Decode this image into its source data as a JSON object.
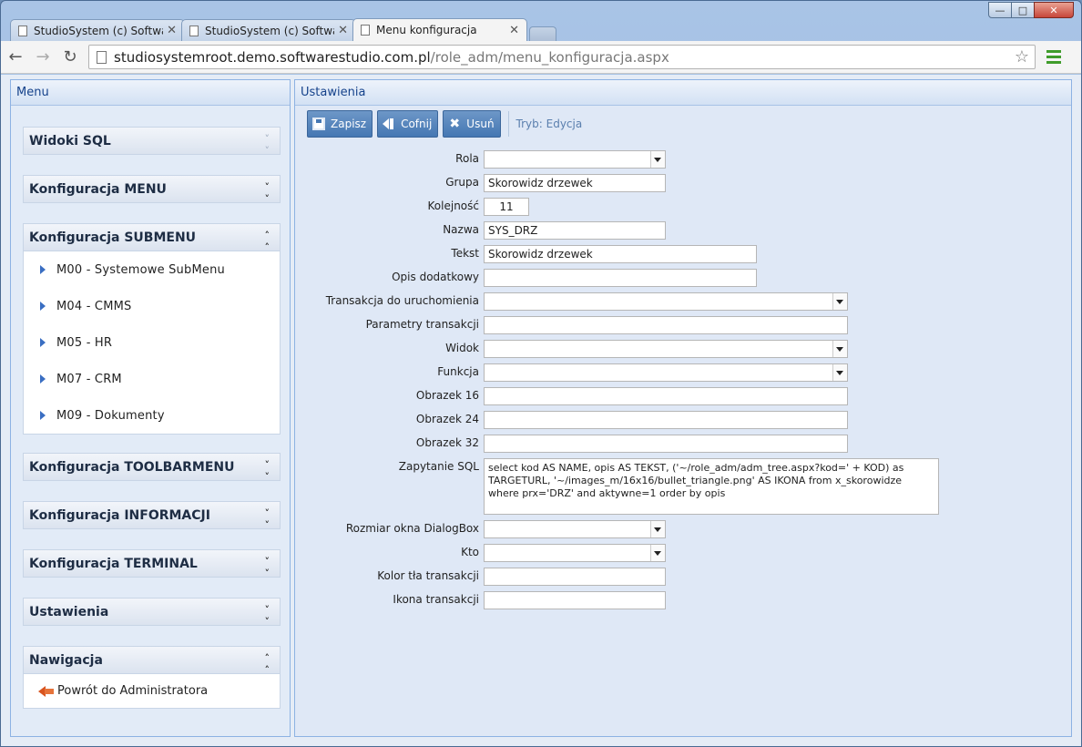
{
  "browser": {
    "tabs": [
      {
        "label": "StudioSystem (c) Software",
        "active": false
      },
      {
        "label": "StudioSystem (c) Software",
        "active": false
      },
      {
        "label": "Menu konfiguracja",
        "active": true
      }
    ],
    "url_host": "studiosystemroot.demo.softwarestudio.com.pl",
    "url_path": "/role_adm/menu_konfiguracja.aspx"
  },
  "left": {
    "title": "Menu",
    "sections": [
      {
        "title": "Widoki SQL",
        "expanded": false
      },
      {
        "title": "Konfiguracja MENU",
        "expanded": false
      },
      {
        "title": "Konfiguracja SUBMENU",
        "expanded": true,
        "items": [
          "M00 - Systemowe SubMenu",
          "M04 - CMMS",
          "M05 - HR",
          "M07 - CRM",
          "M09 - Dokumenty"
        ]
      },
      {
        "title": "Konfiguracja TOOLBARMENU",
        "expanded": false
      },
      {
        "title": "Konfiguracja INFORMACJI",
        "expanded": false
      },
      {
        "title": "Konfiguracja TERMINAL",
        "expanded": false
      },
      {
        "title": "Ustawienia",
        "expanded": false
      },
      {
        "title": "Nawigacja",
        "expanded": true,
        "items": [
          "Powrót do Administratora"
        ]
      }
    ]
  },
  "right": {
    "title": "Ustawienia",
    "actions": {
      "save": "Zapisz",
      "undo": "Cofnij",
      "delete": "Usuń"
    },
    "mode": "Tryb: Edycja",
    "fields": [
      {
        "label": "Rola",
        "value": "",
        "type": "select"
      },
      {
        "label": "Grupa",
        "value": "Skorowidz drzewek",
        "type": "text"
      },
      {
        "label": "Kolejność",
        "value": "11",
        "type": "number"
      },
      {
        "label": "Nazwa",
        "value": "SYS_DRZ",
        "type": "text"
      },
      {
        "label": "Tekst",
        "value": "Skorowidz drzewek",
        "type": "text"
      },
      {
        "label": "Opis dodatkowy",
        "value": "",
        "type": "text"
      },
      {
        "label": "Transakcja do uruchomienia",
        "value": "",
        "type": "select"
      },
      {
        "label": "Parametry transakcji",
        "value": "",
        "type": "text"
      },
      {
        "label": "Widok",
        "value": "",
        "type": "select"
      },
      {
        "label": "Funkcja",
        "value": "",
        "type": "select"
      },
      {
        "label": "Obrazek 16",
        "value": "",
        "type": "text"
      },
      {
        "label": "Obrazek 24",
        "value": "",
        "type": "text"
      },
      {
        "label": "Obrazek 32",
        "value": "",
        "type": "text"
      },
      {
        "label": "Zapytanie SQL",
        "value": "select kod AS NAME, opis AS TEKST, ('~/role_adm/adm_tree.aspx?kod=' + KOD) as TARGETURL, '~/images_m/16x16/bullet_triangle.png' AS IKONA  from x_skorowidze where prx='DRZ' and aktywne=1 order by opis",
        "type": "textarea"
      },
      {
        "label": "Rozmiar okna DialogBox",
        "value": "",
        "type": "select"
      },
      {
        "label": "Kto",
        "value": "",
        "type": "select"
      },
      {
        "label": "Kolor tła transakcji",
        "value": "",
        "type": "text"
      },
      {
        "label": "Ikona transakcji",
        "value": "",
        "type": "text"
      }
    ]
  }
}
